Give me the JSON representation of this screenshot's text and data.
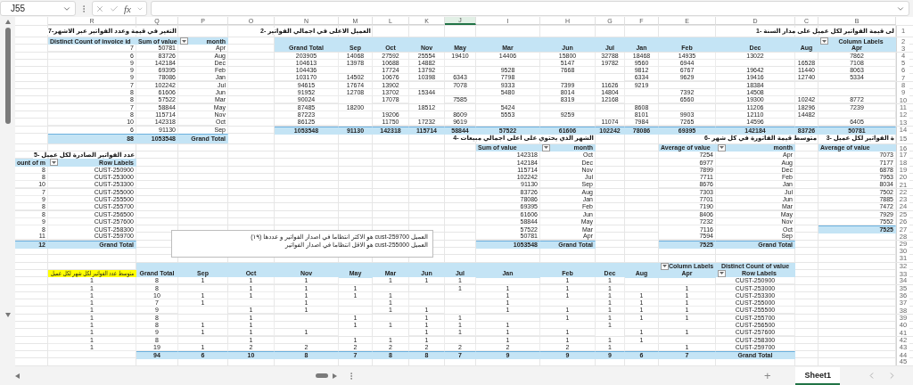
{
  "name_box": "J55",
  "formula_label": "fx",
  "columns": [
    {
      "letter": "R",
      "selected": false
    },
    {
      "letter": "Q",
      "selected": false
    },
    {
      "letter": "P",
      "selected": false
    },
    {
      "letter": "O",
      "selected": false
    },
    {
      "letter": "N",
      "selected": false
    },
    {
      "letter": "M",
      "selected": false
    },
    {
      "letter": "L",
      "selected": false
    },
    {
      "letter": "K",
      "selected": false
    },
    {
      "letter": "J",
      "selected": true
    },
    {
      "letter": "I",
      "selected": false
    },
    {
      "letter": "H",
      "selected": false
    },
    {
      "letter": "G",
      "selected": false
    },
    {
      "letter": "F",
      "selected": false
    },
    {
      "letter": "E",
      "selected": false
    },
    {
      "letter": "D",
      "selected": false
    },
    {
      "letter": "C",
      "selected": false
    },
    {
      "letter": "B",
      "selected": false
    }
  ],
  "rows": [
    {
      "number": "1",
      "kind": "titles",
      "cells": [
        {
          "text": "لى قيمة الفواتير لكل عميل على مدار السنة -1",
          "kind": "title"
        },
        null,
        null,
        null,
        null,
        null,
        null,
        null,
        null,
        null,
        null,
        {
          "text": "العميل الاعلى في اجمالي الفواتير -2",
          "kind": "title"
        },
        null,
        null,
        null,
        {
          "text": "التغير في قيمة وعدد الفواتير عبر الاشهر-7",
          "kind": "title"
        },
        null,
        null
      ]
    },
    {
      "number": "2",
      "cells": [
        null,
        {
          "text": "Distinct Count of invoice id",
          "kind": "hd-l"
        },
        {
          "text": "Sum of value",
          "kind": "hd-l"
        },
        {
          "text": "month",
          "kind": "hd-r",
          "filter": true
        },
        null,
        {
          "kind": "hd"
        },
        {
          "kind": "hd"
        },
        {
          "kind": "hd"
        },
        {
          "kind": "hd"
        },
        {
          "kind": "hd"
        },
        {
          "kind": "hd"
        },
        {
          "kind": "hd"
        },
        {
          "kind": "hd"
        },
        {
          "kind": "hd"
        },
        {
          "kind": "hd"
        },
        {
          "kind": "hd"
        },
        {
          "kind": "hd"
        },
        {
          "text": "Column Labels",
          "kind": "hd",
          "filter": true
        }
      ]
    },
    {
      "number": "3",
      "cells": [
        null,
        {
          "text": "7",
          "kind": "num"
        },
        {
          "text": "50781",
          "kind": "num"
        },
        {
          "text": "Apr",
          "kind": "num"
        },
        null,
        {
          "text": "Grand Total",
          "kind": "hd"
        },
        {
          "text": "Sep",
          "kind": "hd"
        },
        {
          "text": "Oct",
          "kind": "hd"
        },
        {
          "text": "Nov",
          "kind": "hd"
        },
        {
          "text": "May",
          "kind": "hd"
        },
        {
          "text": "Mar",
          "kind": "hd"
        },
        {
          "text": "Jun",
          "kind": "hd"
        },
        {
          "text": "Jul",
          "kind": "hd"
        },
        {
          "text": "Jan",
          "kind": "hd"
        },
        {
          "text": "Feb",
          "kind": "hd"
        },
        {
          "text": "Dec",
          "kind": "hd"
        },
        {
          "text": "Aug",
          "kind": "hd"
        },
        {
          "text": "Apr",
          "kind": "hd"
        }
      ]
    },
    {
      "number": "4",
      "cells": [
        null,
        {
          "text": "6",
          "kind": "num"
        },
        {
          "text": "83726",
          "kind": "num"
        },
        {
          "text": "Aug",
          "kind": "num"
        },
        null,
        {
          "text": "203905",
          "kind": "mid"
        },
        {
          "text": "14068",
          "kind": "mid"
        },
        {
          "text": "27592",
          "kind": "mid"
        },
        {
          "text": "25554",
          "kind": "mid"
        },
        {
          "text": "19410",
          "kind": "mid"
        },
        {
          "text": "14406",
          "kind": "mid"
        },
        {
          "text": "15800",
          "kind": "mid"
        },
        {
          "text": "32788",
          "kind": "mid"
        },
        {
          "text": "18468",
          "kind": "mid"
        },
        {
          "text": "14935",
          "kind": "mid"
        },
        {
          "text": "13022",
          "kind": "mid"
        },
        null,
        {
          "text": "7862",
          "kind": "mid"
        }
      ]
    },
    {
      "number": "5",
      "cells": [
        null,
        {
          "text": "9",
          "kind": "num"
        },
        {
          "text": "142184",
          "kind": "num"
        },
        {
          "text": "Dec",
          "kind": "num"
        },
        null,
        {
          "text": "104613",
          "kind": "mid"
        },
        {
          "text": "13978",
          "kind": "mid"
        },
        {
          "text": "10688",
          "kind": "mid"
        },
        {
          "text": "14882",
          "kind": "mid"
        },
        null,
        null,
        {
          "text": "5147",
          "kind": "mid"
        },
        {
          "text": "19782",
          "kind": "mid"
        },
        {
          "text": "9560",
          "kind": "mid"
        },
        {
          "text": "6944",
          "kind": "mid"
        },
        null,
        {
          "text": "16528",
          "kind": "mid"
        },
        {
          "text": "7108",
          "kind": "mid"
        }
      ]
    },
    {
      "number": "6",
      "cells": [
        null,
        {
          "text": "9",
          "kind": "num"
        },
        {
          "text": "69395",
          "kind": "num"
        },
        {
          "text": "Feb",
          "kind": "num"
        },
        null,
        {
          "text": "104436",
          "kind": "mid"
        },
        null,
        {
          "text": "17724",
          "kind": "mid"
        },
        {
          "text": "13792",
          "kind": "mid"
        },
        null,
        {
          "text": "9528",
          "kind": "mid"
        },
        {
          "text": "7668",
          "kind": "mid"
        },
        null,
        {
          "text": "9812",
          "kind": "mid"
        },
        {
          "text": "6767",
          "kind": "mid"
        },
        {
          "text": "19642",
          "kind": "mid"
        },
        {
          "text": "11440",
          "kind": "mid"
        },
        {
          "text": "8063",
          "kind": "mid"
        }
      ]
    },
    {
      "number": "7",
      "cells": [
        null,
        {
          "text": "9",
          "kind": "num"
        },
        {
          "text": "78086",
          "kind": "num"
        },
        {
          "text": "Jan",
          "kind": "num"
        },
        null,
        {
          "text": "103170",
          "kind": "mid"
        },
        {
          "text": "14502",
          "kind": "mid"
        },
        {
          "text": "10676",
          "kind": "mid"
        },
        {
          "text": "10398",
          "kind": "mid"
        },
        {
          "text": "6343",
          "kind": "mid"
        },
        {
          "text": "7798",
          "kind": "mid"
        },
        null,
        null,
        {
          "text": "6334",
          "kind": "mid"
        },
        {
          "text": "9629",
          "kind": "mid"
        },
        {
          "text": "19416",
          "kind": "mid"
        },
        {
          "text": "12740",
          "kind": "mid"
        },
        {
          "text": "5334",
          "kind": "mid"
        }
      ]
    },
    {
      "number": "8",
      "cells": [
        null,
        {
          "text": "7",
          "kind": "num"
        },
        {
          "text": "102242",
          "kind": "num"
        },
        {
          "text": "Jul",
          "kind": "num"
        },
        null,
        {
          "text": "94615",
          "kind": "mid"
        },
        {
          "text": "17674",
          "kind": "mid"
        },
        {
          "text": "13902",
          "kind": "mid"
        },
        null,
        {
          "text": "7078",
          "kind": "mid"
        },
        {
          "text": "9333",
          "kind": "mid"
        },
        {
          "text": "7399",
          "kind": "mid"
        },
        {
          "text": "11626",
          "kind": "mid"
        },
        {
          "text": "9219",
          "kind": "mid"
        },
        null,
        {
          "text": "18384",
          "kind": "mid"
        }
      ]
    },
    {
      "number": "9",
      "cells": [
        null,
        {
          "text": "8",
          "kind": "num"
        },
        {
          "text": "61606",
          "kind": "num"
        },
        {
          "text": "Jun",
          "kind": "num"
        },
        null,
        {
          "text": "91952",
          "kind": "mid"
        },
        {
          "text": "12708",
          "kind": "mid"
        },
        {
          "text": "13702",
          "kind": "mid"
        },
        {
          "text": "15344",
          "kind": "mid"
        },
        null,
        {
          "text": "5480",
          "kind": "mid"
        },
        {
          "text": "8014",
          "kind": "mid"
        },
        {
          "text": "14804",
          "kind": "mid"
        },
        null,
        {
          "text": "7392",
          "kind": "mid"
        },
        {
          "text": "14508",
          "kind": "mid"
        }
      ]
    },
    {
      "number": "10",
      "cells": [
        null,
        {
          "text": "8",
          "kind": "num"
        },
        {
          "text": "57522",
          "kind": "num"
        },
        {
          "text": "Mar",
          "kind": "num"
        },
        null,
        {
          "text": "90024",
          "kind": "mid"
        },
        null,
        {
          "text": "17078",
          "kind": "mid"
        },
        null,
        {
          "text": "7585",
          "kind": "mid"
        },
        null,
        {
          "text": "8319",
          "kind": "mid"
        },
        {
          "text": "12168",
          "kind": "mid"
        },
        null,
        {
          "text": "6560",
          "kind": "mid"
        },
        {
          "text": "19300",
          "kind": "mid"
        },
        {
          "text": "10242",
          "kind": "mid"
        },
        {
          "text": "8772",
          "kind": "mid"
        }
      ]
    },
    {
      "number": "11",
      "cells": [
        null,
        {
          "text": "7",
          "kind": "num"
        },
        {
          "text": "58844",
          "kind": "num"
        },
        {
          "text": "May",
          "kind": "num"
        },
        null,
        {
          "text": "87485",
          "kind": "mid"
        },
        {
          "text": "18200",
          "kind": "mid"
        },
        null,
        {
          "text": "18512",
          "kind": "mid"
        },
        null,
        {
          "text": "5424",
          "kind": "mid"
        },
        null,
        null,
        {
          "text": "8608",
          "kind": "mid"
        },
        null,
        {
          "text": "11206",
          "kind": "mid"
        },
        {
          "text": "18296",
          "kind": "mid"
        },
        {
          "text": "7239",
          "kind": "mid"
        }
      ]
    },
    {
      "number": "12",
      "cells": [
        null,
        {
          "text": "8",
          "kind": "num"
        },
        {
          "text": "115714",
          "kind": "num"
        },
        {
          "text": "Nov",
          "kind": "num"
        },
        null,
        {
          "text": "87223",
          "kind": "mid"
        },
        null,
        {
          "text": "19206",
          "kind": "mid"
        },
        null,
        {
          "text": "8609",
          "kind": "mid"
        },
        {
          "text": "5553",
          "kind": "mid"
        },
        {
          "text": "9259",
          "kind": "mid"
        },
        null,
        {
          "text": "8101",
          "kind": "mid"
        },
        {
          "text": "9903",
          "kind": "mid"
        },
        {
          "text": "12110",
          "kind": "mid"
        },
        {
          "text": "14482",
          "kind": "mid"
        }
      ]
    },
    {
      "number": "13",
      "cells": [
        null,
        {
          "text": "10",
          "kind": "num"
        },
        {
          "text": "142318",
          "kind": "num"
        },
        {
          "text": "Oct",
          "kind": "num"
        },
        null,
        {
          "text": "86125",
          "kind": "mid"
        },
        null,
        {
          "text": "11750",
          "kind": "mid"
        },
        {
          "text": "17232",
          "kind": "mid"
        },
        {
          "text": "9619",
          "kind": "mid"
        },
        null,
        null,
        {
          "text": "11074",
          "kind": "mid"
        },
        {
          "text": "7984",
          "kind": "mid"
        },
        {
          "text": "7265",
          "kind": "mid"
        },
        {
          "text": "14596",
          "kind": "mid"
        },
        null,
        {
          "text": "6405",
          "kind": "mid"
        }
      ]
    },
    {
      "number": "14",
      "cells": [
        null,
        {
          "text": "6",
          "kind": "num"
        },
        {
          "text": "91130",
          "kind": "num"
        },
        {
          "text": "Sep",
          "kind": "num"
        },
        null,
        {
          "text": "1053548",
          "kind": "tot-c"
        },
        {
          "text": "91130",
          "kind": "tot-c"
        },
        {
          "text": "142318",
          "kind": "tot-c"
        },
        {
          "text": "115714",
          "kind": "tot-c"
        },
        {
          "text": "58844",
          "kind": "tot-c"
        },
        {
          "text": "57522",
          "kind": "tot-c"
        },
        {
          "text": "61606",
          "kind": "tot-c"
        },
        {
          "text": "102242",
          "kind": "tot-c"
        },
        {
          "text": "78086",
          "kind": "tot-c"
        },
        {
          "text": "69395",
          "kind": "tot-c"
        },
        {
          "text": "142184",
          "kind": "tot-c"
        },
        {
          "text": "83726",
          "kind": "tot-c"
        },
        {
          "text": "50781",
          "kind": "tot-c"
        }
      ]
    },
    {
      "number": "15",
      "cells": [
        null,
        {
          "text": "88",
          "kind": "tot"
        },
        {
          "text": "1053548",
          "kind": "tot"
        },
        {
          "text": "Grand Total",
          "kind": "tot"
        },
        null,
        null,
        null,
        null,
        null,
        null,
        null,
        {
          "text": "الشهر الذي يحتوي على اعلى اجمالي مبيعات -4",
          "kind": "title"
        },
        null,
        null,
        null,
        null,
        {
          "text": "متوسط قيمة الفاتورة في كل شهر -6",
          "kind": "title"
        },
        {
          "text": "ة الفواتير لكل عميل -3",
          "kind": "title"
        }
      ]
    },
    {
      "number": "16",
      "cells": [
        null,
        null,
        null,
        null,
        null,
        null,
        null,
        null,
        null,
        null,
        {
          "text": "Sum of value",
          "kind": "hd-l"
        },
        {
          "text": "month",
          "kind": "hd-r",
          "filter": true
        },
        null,
        null,
        {
          "text": "Average of value",
          "kind": "hd-l"
        },
        {
          "text": "month",
          "kind": "hd-r",
          "filter": true
        },
        null,
        {
          "text": "Average of value",
          "kind": "hd-l"
        }
      ]
    },
    {
      "number": "17",
      "cells": [
        null,
        {
          "text": "عدد الفواتير الصادرة لكل عميل -5",
          "kind": "title"
        },
        null,
        null,
        null,
        null,
        null,
        null,
        null,
        null,
        {
          "text": "142318",
          "kind": "num"
        },
        {
          "text": "Oct",
          "kind": "num"
        },
        null,
        null,
        {
          "text": "7254",
          "kind": "num"
        },
        {
          "text": "Apr",
          "kind": "num"
        },
        null,
        {
          "text": "7073",
          "kind": "num"
        }
      ]
    },
    {
      "number": "18",
      "cells": [
        {
          "text": "ount of m",
          "kind": "hd-l"
        },
        {
          "text": "Row Labels",
          "kind": "hd-r",
          "filter": true
        },
        null,
        null,
        null,
        null,
        null,
        null,
        null,
        null,
        {
          "text": "142184",
          "kind": "num"
        },
        {
          "text": "Dec",
          "kind": "num"
        },
        null,
        null,
        {
          "text": "6977",
          "kind": "num"
        },
        {
          "text": "Aug",
          "kind": "num"
        },
        null,
        {
          "text": "7177",
          "kind": "num"
        }
      ]
    },
    {
      "number": "19",
      "cells": [
        {
          "text": "8",
          "kind": "num"
        },
        {
          "text": "CUST-250900",
          "kind": "num"
        },
        null,
        null,
        null,
        null,
        null,
        null,
        null,
        null,
        {
          "text": "115714",
          "kind": "num"
        },
        {
          "text": "Nov",
          "kind": "num"
        },
        null,
        null,
        {
          "text": "7899",
          "kind": "num"
        },
        {
          "text": "Dec",
          "kind": "num"
        },
        null,
        {
          "text": "6878",
          "kind": "num"
        }
      ]
    },
    {
      "number": "20",
      "cells": [
        {
          "text": "8",
          "kind": "num"
        },
        {
          "text": "CUST-253000",
          "kind": "num"
        },
        null,
        null,
        null,
        null,
        null,
        null,
        null,
        null,
        {
          "text": "102242",
          "kind": "num"
        },
        {
          "text": "Jul",
          "kind": "num"
        },
        null,
        null,
        {
          "text": "7711",
          "kind": "num"
        },
        {
          "text": "Feb",
          "kind": "num"
        },
        null,
        {
          "text": "7953",
          "kind": "num"
        }
      ]
    },
    {
      "number": "21",
      "cells": [
        {
          "text": "10",
          "kind": "num"
        },
        {
          "text": "CUST-253300",
          "kind": "num"
        },
        null,
        null,
        null,
        null,
        null,
        null,
        null,
        null,
        {
          "text": "91130",
          "kind": "num"
        },
        {
          "text": "Sep",
          "kind": "num"
        },
        null,
        null,
        {
          "text": "8676",
          "kind": "num"
        },
        {
          "text": "Jan",
          "kind": "num"
        },
        null,
        {
          "text": "8034",
          "kind": "num"
        }
      ]
    },
    {
      "number": "22",
      "cells": [
        {
          "text": "7",
          "kind": "num"
        },
        {
          "text": "CUST-255000",
          "kind": "num"
        },
        null,
        null,
        null,
        null,
        null,
        null,
        null,
        null,
        {
          "text": "83726",
          "kind": "num"
        },
        {
          "text": "Aug",
          "kind": "num"
        },
        null,
        null,
        {
          "text": "7303",
          "kind": "num"
        },
        {
          "text": "Jul",
          "kind": "num"
        },
        null,
        {
          "text": "7502",
          "kind": "num"
        }
      ]
    },
    {
      "number": "23",
      "cells": [
        {
          "text": "9",
          "kind": "num"
        },
        {
          "text": "CUST-255500",
          "kind": "num"
        },
        null,
        null,
        null,
        null,
        null,
        null,
        null,
        null,
        {
          "text": "78086",
          "kind": "num"
        },
        {
          "text": "Jan",
          "kind": "num"
        },
        null,
        null,
        {
          "text": "7701",
          "kind": "num"
        },
        {
          "text": "Jun",
          "kind": "num"
        },
        null,
        {
          "text": "7885",
          "kind": "num"
        }
      ]
    },
    {
      "number": "24",
      "cells": [
        {
          "text": "8",
          "kind": "num"
        },
        {
          "text": "CUST-255700",
          "kind": "num"
        },
        null,
        null,
        null,
        null,
        null,
        null,
        null,
        null,
        {
          "text": "69395",
          "kind": "num"
        },
        {
          "text": "Feb",
          "kind": "num"
        },
        null,
        null,
        {
          "text": "7190",
          "kind": "num"
        },
        {
          "text": "Mar",
          "kind": "num"
        },
        null,
        {
          "text": "7472",
          "kind": "num"
        }
      ]
    },
    {
      "number": "25",
      "cells": [
        {
          "text": "8",
          "kind": "num"
        },
        {
          "text": "CUST-256500",
          "kind": "num"
        },
        null,
        null,
        null,
        null,
        null,
        null,
        null,
        null,
        {
          "text": "61606",
          "kind": "num"
        },
        {
          "text": "Jun",
          "kind": "num"
        },
        null,
        null,
        {
          "text": "8406",
          "kind": "num"
        },
        {
          "text": "May",
          "kind": "num"
        },
        null,
        {
          "text": "7929",
          "kind": "num"
        }
      ]
    },
    {
      "number": "26",
      "cells": [
        {
          "text": "9",
          "kind": "num"
        },
        {
          "text": "CUST-257600",
          "kind": "num"
        },
        null,
        null,
        null,
        null,
        null,
        null,
        null,
        null,
        {
          "text": "58844",
          "kind": "num"
        },
        {
          "text": "May",
          "kind": "num"
        },
        null,
        null,
        {
          "text": "7232",
          "kind": "num"
        },
        {
          "text": "Nov",
          "kind": "num"
        },
        null,
        {
          "text": "7552",
          "kind": "num"
        }
      ]
    },
    {
      "number": "27",
      "cells": [
        {
          "text": "8",
          "kind": "num"
        },
        {
          "text": "CUST-258300",
          "kind": "num"
        },
        null,
        null,
        null,
        null,
        null,
        null,
        null,
        null,
        {
          "text": "57522",
          "kind": "num"
        },
        {
          "text": "Mar",
          "kind": "num"
        },
        null,
        null,
        {
          "text": "7116",
          "kind": "num"
        },
        {
          "text": "Oct",
          "kind": "num"
        },
        null,
        {
          "text": "7525",
          "kind": "tot"
        }
      ]
    },
    {
      "number": "28",
      "cells": [
        {
          "text": "11",
          "kind": "num"
        },
        {
          "text": "CUST-259700",
          "kind": "num"
        },
        null,
        null,
        null,
        null,
        null,
        null,
        null,
        null,
        {
          "text": "50781",
          "kind": "num"
        },
        {
          "text": "Apr",
          "kind": "num"
        },
        null,
        null,
        {
          "text": "7594",
          "kind": "num"
        },
        {
          "text": "Sep",
          "kind": "num"
        }
      ]
    },
    {
      "number": "29",
      "cells": [
        {
          "text": "12",
          "kind": "tot"
        },
        {
          "text": "Grand Total",
          "kind": "tot"
        },
        null,
        null,
        null,
        null,
        null,
        null,
        null,
        null,
        {
          "text": "1053548",
          "kind": "tot"
        },
        {
          "text": "Grand Total",
          "kind": "tot"
        },
        null,
        null,
        {
          "text": "7525",
          "kind": "tot"
        },
        {
          "text": "Grand Total",
          "kind": "tot"
        }
      ]
    },
    {
      "number": "30"
    },
    {
      "number": "31"
    },
    {
      "number": "32",
      "cells": [
        null,
        null,
        {
          "kind": "hd"
        },
        {
          "kind": "hd"
        },
        {
          "kind": "hd"
        },
        {
          "kind": "hd"
        },
        {
          "kind": "hd"
        },
        {
          "kind": "hd"
        },
        {
          "kind": "hd"
        },
        {
          "kind": "hd"
        },
        {
          "kind": "hd"
        },
        {
          "kind": "hd"
        },
        {
          "kind": "hd"
        },
        {
          "kind": "hd"
        },
        {
          "text": "Column Labels",
          "kind": "hd-l",
          "filter": true
        },
        {
          "text": "Distinct Count of value",
          "kind": "hd"
        }
      ]
    },
    {
      "number": "33",
      "cells": [
        null,
        {
          "text": "متوسط عدد الفواتير لكل شهر لكل عميل",
          "kind": "mark"
        },
        {
          "text": "Grand Total",
          "kind": "hd"
        },
        {
          "text": "Sep",
          "kind": "hd"
        },
        {
          "text": "Oct",
          "kind": "hd"
        },
        {
          "text": "Nov",
          "kind": "hd"
        },
        {
          "text": "May",
          "kind": "hd"
        },
        {
          "text": "Mar",
          "kind": "hd"
        },
        {
          "text": "Jun",
          "kind": "hd"
        },
        {
          "text": "Jul",
          "kind": "hd"
        },
        {
          "text": "Jan",
          "kind": "hd"
        },
        {
          "text": "Feb",
          "kind": "hd"
        },
        {
          "text": "Dec",
          "kind": "hd"
        },
        {
          "text": "Aug",
          "kind": "hd"
        },
        {
          "text": "Apr",
          "kind": "hd"
        },
        {
          "text": "Row Labels",
          "kind": "hd",
          "filter": true
        }
      ]
    },
    {
      "number": "34",
      "cells": [
        null,
        {
          "text": "1",
          "kind": "mid"
        },
        {
          "text": "8",
          "kind": "mid"
        },
        {
          "text": "1",
          "kind": "mid"
        },
        {
          "text": "1",
          "kind": "mid"
        },
        {
          "text": "1",
          "kind": "mid"
        },
        null,
        {
          "text": "1",
          "kind": "mid"
        },
        {
          "text": "1",
          "kind": "mid"
        },
        {
          "text": "1",
          "kind": "mid"
        },
        null,
        {
          "text": "1",
          "kind": "mid"
        },
        {
          "text": "1",
          "kind": "mid"
        },
        null,
        null,
        {
          "text": "CUST-250900",
          "kind": "mid"
        }
      ]
    },
    {
      "number": "35",
      "cells": [
        null,
        {
          "text": "1",
          "kind": "mid"
        },
        {
          "text": "8",
          "kind": "mid"
        },
        null,
        {
          "text": "1",
          "kind": "mid"
        },
        {
          "text": "1",
          "kind": "mid"
        },
        {
          "text": "1",
          "kind": "mid"
        },
        null,
        null,
        {
          "text": "1",
          "kind": "mid"
        },
        {
          "text": "1",
          "kind": "mid"
        },
        {
          "text": "1",
          "kind": "mid"
        },
        {
          "text": "1",
          "kind": "mid"
        },
        null,
        {
          "text": "1",
          "kind": "mid"
        },
        {
          "text": "CUST-253000",
          "kind": "mid"
        }
      ]
    },
    {
      "number": "36",
      "cells": [
        null,
        {
          "text": "1",
          "kind": "mid"
        },
        {
          "text": "10",
          "kind": "mid"
        },
        {
          "text": "1",
          "kind": "mid"
        },
        {
          "text": "1",
          "kind": "mid"
        },
        {
          "text": "1",
          "kind": "mid"
        },
        {
          "text": "1",
          "kind": "mid"
        },
        {
          "text": "1",
          "kind": "mid"
        },
        null,
        null,
        {
          "text": "1",
          "kind": "mid"
        },
        {
          "text": "1",
          "kind": "mid"
        },
        {
          "text": "1",
          "kind": "mid"
        },
        {
          "text": "1",
          "kind": "mid"
        },
        {
          "text": "1",
          "kind": "mid"
        },
        {
          "text": "CUST-253300",
          "kind": "mid"
        }
      ]
    },
    {
      "number": "37",
      "cells": [
        null,
        {
          "text": "1",
          "kind": "mid"
        },
        {
          "text": "7",
          "kind": "mid"
        },
        {
          "text": "1",
          "kind": "mid"
        },
        null,
        {
          "text": "1",
          "kind": "mid"
        },
        null,
        {
          "text": "1",
          "kind": "mid"
        },
        null,
        null,
        {
          "text": "1",
          "kind": "mid"
        },
        null,
        {
          "text": "1",
          "kind": "mid"
        },
        {
          "text": "1",
          "kind": "mid"
        },
        {
          "text": "1",
          "kind": "mid"
        },
        {
          "text": "CUST-255000",
          "kind": "mid"
        }
      ]
    },
    {
      "number": "38",
      "cells": [
        null,
        {
          "text": "1",
          "kind": "mid"
        },
        {
          "text": "9",
          "kind": "mid"
        },
        null,
        {
          "text": "1",
          "kind": "mid"
        },
        {
          "text": "1",
          "kind": "mid"
        },
        null,
        {
          "text": "1",
          "kind": "mid"
        },
        {
          "text": "1",
          "kind": "mid"
        },
        null,
        {
          "text": "1",
          "kind": "mid"
        },
        {
          "text": "1",
          "kind": "mid"
        },
        {
          "text": "1",
          "kind": "mid"
        },
        {
          "text": "1",
          "kind": "mid"
        },
        {
          "text": "1",
          "kind": "mid"
        },
        {
          "text": "CUST-255500",
          "kind": "mid"
        }
      ]
    },
    {
      "number": "39",
      "cells": [
        null,
        {
          "text": "1",
          "kind": "mid"
        },
        {
          "text": "8",
          "kind": "mid"
        },
        null,
        {
          "text": "1",
          "kind": "mid"
        },
        null,
        {
          "text": "1",
          "kind": "mid"
        },
        null,
        {
          "text": "1",
          "kind": "mid"
        },
        {
          "text": "1",
          "kind": "mid"
        },
        null,
        {
          "text": "1",
          "kind": "mid"
        },
        {
          "text": "1",
          "kind": "mid"
        },
        {
          "text": "1",
          "kind": "mid"
        },
        {
          "text": "1",
          "kind": "mid"
        },
        {
          "text": "CUST-255700",
          "kind": "mid"
        }
      ]
    },
    {
      "number": "40",
      "cells": [
        null,
        {
          "text": "1",
          "kind": "mid"
        },
        {
          "text": "8",
          "kind": "mid"
        },
        {
          "text": "1",
          "kind": "mid"
        },
        {
          "text": "1",
          "kind": "mid"
        },
        null,
        {
          "text": "1",
          "kind": "mid"
        },
        {
          "text": "1",
          "kind": "mid"
        },
        {
          "text": "1",
          "kind": "mid"
        },
        {
          "text": "1",
          "kind": "mid"
        },
        {
          "text": "1",
          "kind": "mid"
        },
        null,
        {
          "text": "1",
          "kind": "mid"
        },
        null,
        null,
        {
          "text": "CUST-256500",
          "kind": "mid"
        }
      ]
    },
    {
      "number": "41",
      "cells": [
        null,
        {
          "text": "1",
          "kind": "mid"
        },
        {
          "text": "9",
          "kind": "mid"
        },
        {
          "text": "1",
          "kind": "mid"
        },
        {
          "text": "1",
          "kind": "mid"
        },
        {
          "text": "1",
          "kind": "mid"
        },
        null,
        null,
        {
          "text": "1",
          "kind": "mid"
        },
        {
          "text": "1",
          "kind": "mid"
        },
        {
          "text": "1",
          "kind": "mid"
        },
        {
          "text": "1",
          "kind": "mid"
        },
        null,
        {
          "text": "1",
          "kind": "mid"
        },
        {
          "text": "1",
          "kind": "mid"
        },
        {
          "text": "CUST-257600",
          "kind": "mid"
        }
      ]
    },
    {
      "number": "42",
      "cells": [
        null,
        {
          "text": "1",
          "kind": "mid"
        },
        {
          "text": "8",
          "kind": "mid"
        },
        null,
        {
          "text": "1",
          "kind": "mid"
        },
        null,
        {
          "text": "1",
          "kind": "mid"
        },
        {
          "text": "1",
          "kind": "mid"
        },
        {
          "text": "1",
          "kind": "mid"
        },
        null,
        {
          "text": "1",
          "kind": "mid"
        },
        {
          "text": "1",
          "kind": "mid"
        },
        {
          "text": "1",
          "kind": "mid"
        },
        {
          "text": "1",
          "kind": "mid"
        },
        null,
        {
          "text": "CUST-258300",
          "kind": "mid"
        }
      ]
    },
    {
      "number": "43",
      "cells": [
        null,
        {
          "text": "1",
          "kind": "mid"
        },
        {
          "text": "19",
          "kind": "mid"
        },
        {
          "text": "1",
          "kind": "mid"
        },
        {
          "text": "2",
          "kind": "mid"
        },
        {
          "text": "2",
          "kind": "mid"
        },
        {
          "text": "2",
          "kind": "mid"
        },
        {
          "text": "2",
          "kind": "mid"
        },
        {
          "text": "2",
          "kind": "mid"
        },
        {
          "text": "2",
          "kind": "mid"
        },
        {
          "text": "2",
          "kind": "mid"
        },
        {
          "text": "2",
          "kind": "mid"
        },
        {
          "text": "1",
          "kind": "mid"
        },
        null,
        {
          "text": "1",
          "kind": "mid"
        },
        {
          "text": "CUST-259700",
          "kind": "mid"
        }
      ]
    },
    {
      "number": "44",
      "cells": [
        null,
        null,
        {
          "text": "94",
          "kind": "tot-c"
        },
        {
          "text": "6",
          "kind": "tot-c"
        },
        {
          "text": "10",
          "kind": "tot-c"
        },
        {
          "text": "8",
          "kind": "tot-c"
        },
        {
          "text": "7",
          "kind": "tot-c"
        },
        {
          "text": "8",
          "kind": "tot-c"
        },
        {
          "text": "8",
          "kind": "tot-c"
        },
        {
          "text": "7",
          "kind": "tot-c"
        },
        {
          "text": "9",
          "kind": "tot-c"
        },
        {
          "text": "9",
          "kind": "tot-c"
        },
        {
          "text": "9",
          "kind": "tot-c"
        },
        {
          "text": "6",
          "kind": "tot-c"
        },
        {
          "text": "7",
          "kind": "tot-c"
        },
        {
          "text": "Grand Total",
          "kind": "tot-c"
        }
      ]
    },
    {
      "number": "45"
    }
  ],
  "note": {
    "lines": [
      "العميل cust-259700 هو الاكثر انتظاما في اصدار الفواتير و عددها (١٩)",
      "العميل cust-255000 هو الاقل انتظاما في اصدار الفواتير"
    ]
  },
  "add_sheet": "+",
  "sheet_tabs": [
    {
      "label": "Sheet1",
      "selected": true
    }
  ]
}
